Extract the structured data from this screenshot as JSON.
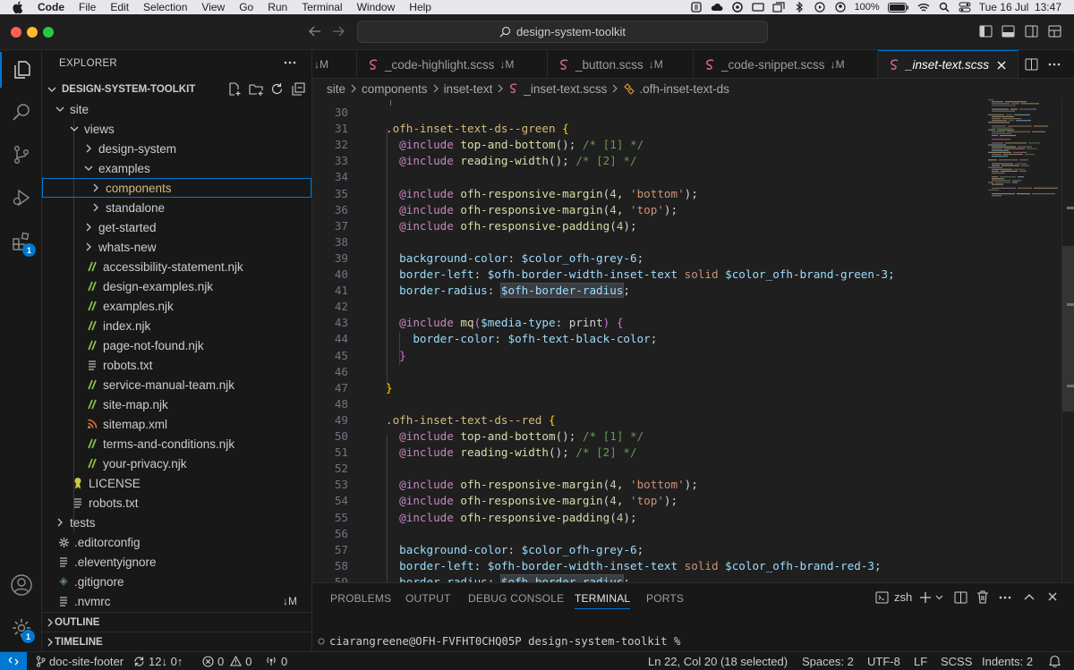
{
  "menubar": {
    "app": "Code",
    "items": [
      "File",
      "Edit",
      "Selection",
      "View",
      "Go",
      "Run",
      "Terminal",
      "Window",
      "Help"
    ],
    "battery": "100%",
    "datetime": "Tue 16 Jul  13:47"
  },
  "titlebar": {
    "search": "design-system-toolkit"
  },
  "activity": {
    "extensions_badge": "1",
    "manage_badge": "1"
  },
  "explorer": {
    "header": "EXPLORER",
    "root": "DESIGN-SYSTEM-TOOLKIT",
    "tree": [
      {
        "label": "site",
        "kind": "folder-open",
        "depth": 1
      },
      {
        "label": "views",
        "kind": "folder-open",
        "depth": 2
      },
      {
        "label": "design-system",
        "kind": "folder",
        "depth": 3
      },
      {
        "label": "examples",
        "kind": "folder-open",
        "depth": 3
      },
      {
        "label": "components",
        "kind": "folder",
        "depth": 4,
        "selected": true
      },
      {
        "label": "standalone",
        "kind": "folder",
        "depth": 4
      },
      {
        "label": "get-started",
        "kind": "folder",
        "depth": 3
      },
      {
        "label": "whats-new",
        "kind": "folder",
        "depth": 3
      },
      {
        "label": "accessibility-statement.njk",
        "kind": "njk",
        "depth": 3
      },
      {
        "label": "design-examples.njk",
        "kind": "njk",
        "depth": 3
      },
      {
        "label": "examples.njk",
        "kind": "njk",
        "depth": 3
      },
      {
        "label": "index.njk",
        "kind": "njk",
        "depth": 3
      },
      {
        "label": "page-not-found.njk",
        "kind": "njk",
        "depth": 3
      },
      {
        "label": "robots.txt",
        "kind": "txt",
        "depth": 3
      },
      {
        "label": "service-manual-team.njk",
        "kind": "njk",
        "depth": 3
      },
      {
        "label": "site-map.njk",
        "kind": "njk",
        "depth": 3
      },
      {
        "label": "sitemap.xml",
        "kind": "xml",
        "depth": 3
      },
      {
        "label": "terms-and-conditions.njk",
        "kind": "njk",
        "depth": 3
      },
      {
        "label": "your-privacy.njk",
        "kind": "njk",
        "depth": 3
      },
      {
        "label": "LICENSE",
        "kind": "license",
        "depth": 2
      },
      {
        "label": "robots.txt",
        "kind": "txt",
        "depth": 2
      },
      {
        "label": "tests",
        "kind": "folder",
        "depth": 1
      },
      {
        "label": ".editorconfig",
        "kind": "gear",
        "depth": 1
      },
      {
        "label": ".eleventyignore",
        "kind": "txt",
        "depth": 1
      },
      {
        "label": ".gitignore",
        "kind": "git",
        "depth": 1
      },
      {
        "label": ".nvmrc",
        "kind": "txt",
        "depth": 1,
        "status": "↓M"
      }
    ],
    "outline": "OUTLINE",
    "timeline": "TIMELINE"
  },
  "tabs": [
    {
      "label": "",
      "status": "↓M"
    },
    {
      "label": "_code-highlight.scss",
      "status": "↓M"
    },
    {
      "label": "_button.scss",
      "status": "↓M"
    },
    {
      "label": "_code-snippet.scss",
      "status": "↓M"
    },
    {
      "label": "_inset-text.scss",
      "status": "",
      "active": true
    }
  ],
  "breadcrumbs": [
    "site",
    "components",
    "inset-text",
    "_inset-text.scss",
    ".ofh-inset-text-ds"
  ],
  "editor": {
    "lines": [
      {
        "n": "30",
        "h": []
      },
      {
        "n": "31",
        "h": [
          [
            "sel",
            ".ofh-inset-text-ds--green "
          ],
          [
            "p",
            "{"
          ]
        ]
      },
      {
        "n": "32",
        "h": [
          [
            "k",
            "  @include "
          ],
          [
            "f",
            "top-and-bottom"
          ],
          [
            "w",
            "(); "
          ],
          [
            "c",
            "/* [1] */"
          ]
        ]
      },
      {
        "n": "33",
        "h": [
          [
            "k",
            "  @include "
          ],
          [
            "f",
            "reading-width"
          ],
          [
            "w",
            "(); "
          ],
          [
            "c",
            "/* [2] */"
          ]
        ]
      },
      {
        "n": "34",
        "h": []
      },
      {
        "n": "35",
        "h": [
          [
            "k",
            "  @include "
          ],
          [
            "f",
            "ofh-responsive-margin"
          ],
          [
            "w",
            "("
          ],
          [
            "n",
            "4"
          ],
          [
            "w",
            ", "
          ],
          [
            "s",
            "'bottom'"
          ],
          [
            "w",
            ");"
          ]
        ]
      },
      {
        "n": "36",
        "h": [
          [
            "k",
            "  @include "
          ],
          [
            "f",
            "ofh-responsive-margin"
          ],
          [
            "w",
            "("
          ],
          [
            "n",
            "4"
          ],
          [
            "w",
            ", "
          ],
          [
            "s",
            "'top'"
          ],
          [
            "w",
            ");"
          ]
        ]
      },
      {
        "n": "37",
        "h": [
          [
            "k",
            "  @include "
          ],
          [
            "f",
            "ofh-responsive-padding"
          ],
          [
            "w",
            "("
          ],
          [
            "n",
            "4"
          ],
          [
            "w",
            ");"
          ]
        ]
      },
      {
        "n": "38",
        "h": []
      },
      {
        "n": "39",
        "h": [
          [
            "v",
            "  background-color"
          ],
          [
            "w",
            ": "
          ],
          [
            "v",
            "$color_ofh-grey-6"
          ],
          [
            "w",
            ";"
          ]
        ]
      },
      {
        "n": "40",
        "h": [
          [
            "v",
            "  border-left"
          ],
          [
            "w",
            ": "
          ],
          [
            "v",
            "$ofh-border-width-inset-text "
          ],
          [
            "s",
            "solid "
          ],
          [
            "v",
            "$color_ofh-brand-green-3"
          ],
          [
            "w",
            ";"
          ]
        ]
      },
      {
        "n": "41",
        "h": [
          [
            "v",
            "  border-radius"
          ],
          [
            "w",
            ": "
          ],
          [
            "vh",
            "$ofh-border-radius"
          ],
          [
            "w",
            ";"
          ]
        ]
      },
      {
        "n": "42",
        "h": []
      },
      {
        "n": "43",
        "h": [
          [
            "k",
            "  @include "
          ],
          [
            "f",
            "mq"
          ],
          [
            "pp",
            "("
          ],
          [
            "v",
            "$media-type"
          ],
          [
            "w",
            ": print"
          ],
          [
            "pp",
            ")"
          ],
          [
            "w",
            " "
          ],
          [
            "pp",
            "{"
          ]
        ]
      },
      {
        "n": "44",
        "h": [
          [
            "v",
            "    border-color"
          ],
          [
            "w",
            ": "
          ],
          [
            "v",
            "$ofh-text-black-color"
          ],
          [
            "w",
            ";"
          ]
        ]
      },
      {
        "n": "45",
        "h": [
          [
            "pp",
            "  }"
          ]
        ]
      },
      {
        "n": "46",
        "h": []
      },
      {
        "n": "47",
        "h": [
          [
            "p",
            "}"
          ]
        ]
      },
      {
        "n": "48",
        "h": []
      },
      {
        "n": "49",
        "h": [
          [
            "sel",
            ".ofh-inset-text-ds--red "
          ],
          [
            "p",
            "{"
          ]
        ]
      },
      {
        "n": "50",
        "h": [
          [
            "k",
            "  @include "
          ],
          [
            "f",
            "top-and-bottom"
          ],
          [
            "w",
            "(); "
          ],
          [
            "c",
            "/* [1] */"
          ]
        ]
      },
      {
        "n": "51",
        "h": [
          [
            "k",
            "  @include "
          ],
          [
            "f",
            "reading-width"
          ],
          [
            "w",
            "(); "
          ],
          [
            "c",
            "/* [2] */"
          ]
        ]
      },
      {
        "n": "52",
        "h": []
      },
      {
        "n": "53",
        "h": [
          [
            "k",
            "  @include "
          ],
          [
            "f",
            "ofh-responsive-margin"
          ],
          [
            "w",
            "("
          ],
          [
            "n",
            "4"
          ],
          [
            "w",
            ", "
          ],
          [
            "s",
            "'bottom'"
          ],
          [
            "w",
            ");"
          ]
        ]
      },
      {
        "n": "54",
        "h": [
          [
            "k",
            "  @include "
          ],
          [
            "f",
            "ofh-responsive-margin"
          ],
          [
            "w",
            "("
          ],
          [
            "n",
            "4"
          ],
          [
            "w",
            ", "
          ],
          [
            "s",
            "'top'"
          ],
          [
            "w",
            ");"
          ]
        ]
      },
      {
        "n": "55",
        "h": [
          [
            "k",
            "  @include "
          ],
          [
            "f",
            "ofh-responsive-padding"
          ],
          [
            "w",
            "("
          ],
          [
            "n",
            "4"
          ],
          [
            "w",
            ");"
          ]
        ]
      },
      {
        "n": "56",
        "h": []
      },
      {
        "n": "57",
        "h": [
          [
            "v",
            "  background-color"
          ],
          [
            "w",
            ": "
          ],
          [
            "v",
            "$color_ofh-grey-6"
          ],
          [
            "w",
            ";"
          ]
        ]
      },
      {
        "n": "58",
        "h": [
          [
            "v",
            "  border-left"
          ],
          [
            "w",
            ": "
          ],
          [
            "v",
            "$ofh-border-width-inset-text "
          ],
          [
            "s",
            "solid "
          ],
          [
            "v",
            "$color_ofh-brand-red-3"
          ],
          [
            "w",
            ";"
          ]
        ]
      },
      {
        "n": "59",
        "h": [
          [
            "v",
            "  border-radius"
          ],
          [
            "w",
            ": "
          ],
          [
            "vh",
            "$ofh-border-radius"
          ],
          [
            "w",
            ";"
          ]
        ]
      }
    ]
  },
  "panel": {
    "tabs": [
      "PROBLEMS",
      "OUTPUT",
      "DEBUG CONSOLE",
      "TERMINAL",
      "PORTS"
    ],
    "active": "TERMINAL",
    "shell": "zsh",
    "prompt": "ciarangreene@OFH-FVFHT0CHQ05P design-system-toolkit %"
  },
  "status": {
    "branch": "doc-site-footer",
    "sync": "12↓ 0↑",
    "errors": "0",
    "warnings": "0",
    "ports": "0",
    "cursor": "Ln 22, Col 20 (18 selected)",
    "spaces": "Spaces: 2",
    "encoding": "UTF-8",
    "eol": "LF",
    "language": "SCSS",
    "indents": "Indents: 2"
  },
  "colors": {
    "accent": "#0078d4",
    "sass": "#cd6799",
    "njk": "#8dc149",
    "xml": "#e37933"
  }
}
